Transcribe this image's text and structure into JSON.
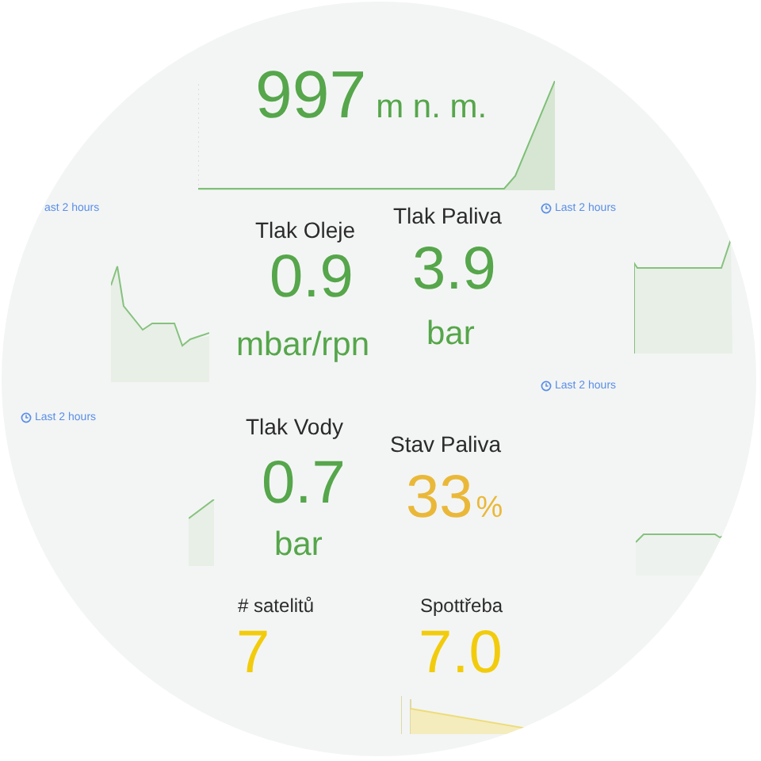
{
  "altitude": {
    "value": "997",
    "unit": "m n. m.",
    "color": "#56a64b"
  },
  "time_ranges": [
    {
      "label": "ast 2 hours"
    },
    {
      "label": "Last 2 hours"
    },
    {
      "label": "Last 2 hours"
    },
    {
      "label": "Last 2 hours"
    }
  ],
  "stats": [
    {
      "title": "Tlak Oleje",
      "value": "0.9",
      "unit": "mbar/rpn",
      "kind": "stacked",
      "color": "#56a64b"
    },
    {
      "title": "Tlak Paliva",
      "value": "3.9",
      "unit": "bar",
      "kind": "stacked",
      "color": "#56a64b"
    },
    {
      "title": "Tlak Vody",
      "value": "0.7",
      "unit": "bar",
      "kind": "stacked",
      "color": "#56a64b"
    },
    {
      "title": "Stav Paliva",
      "value": "33",
      "unit": "%",
      "kind": "inline",
      "color": "#eab839"
    },
    {
      "title": "# satelitů",
      "value": "7",
      "kind": "small",
      "color": "#f2cc0c"
    },
    {
      "title": "Spottřeba",
      "value": "7.0",
      "kind": "small",
      "color": "#f2cc0c"
    }
  ]
}
